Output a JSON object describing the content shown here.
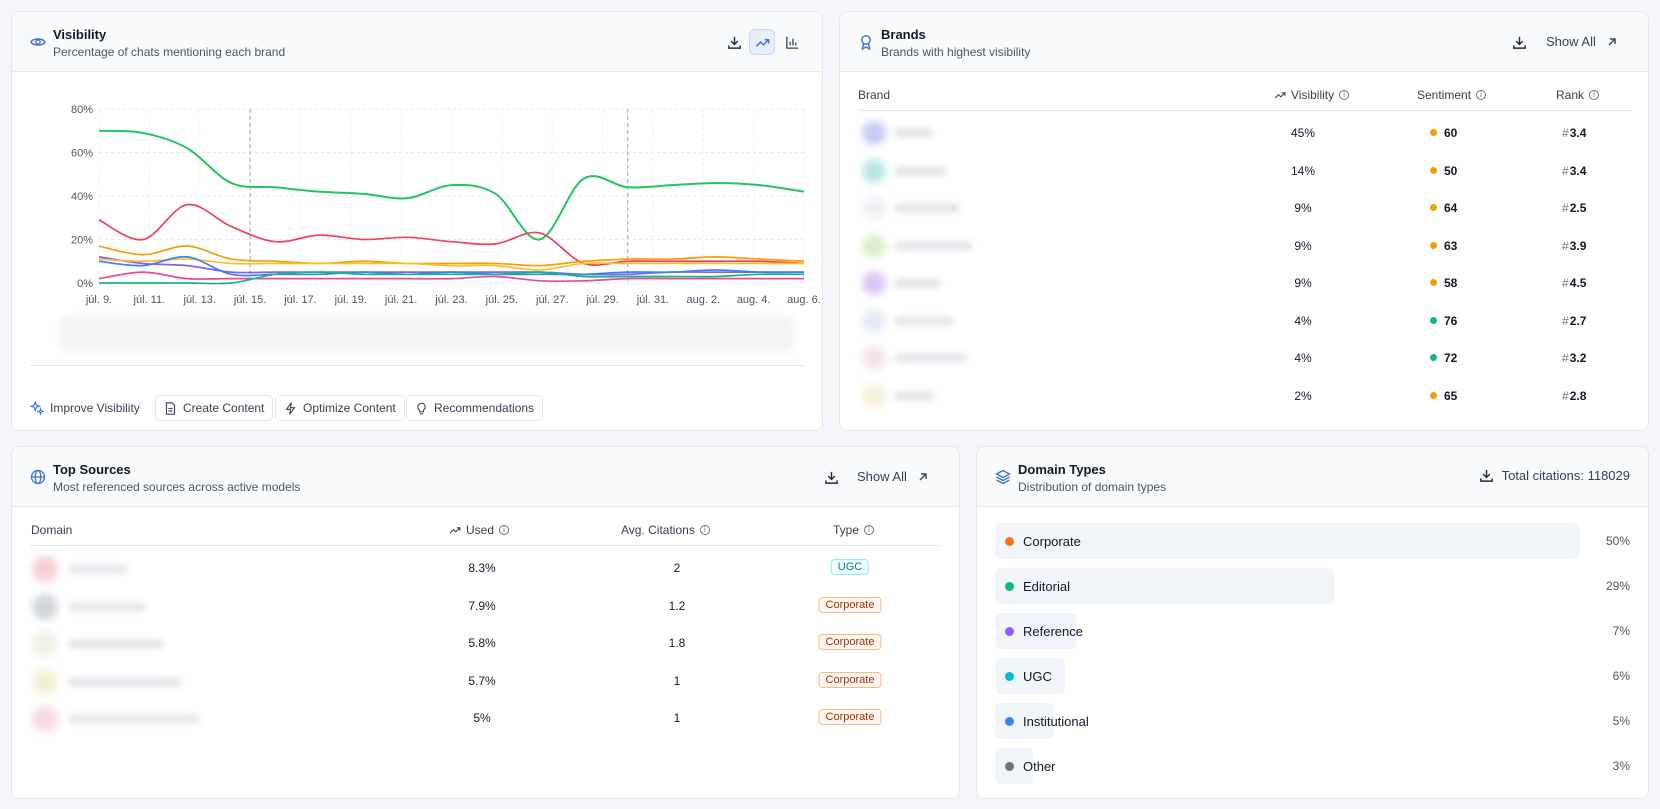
{
  "visibility": {
    "title": "Visibility",
    "subtitle": "Percentage of chats mentioning each brand",
    "icons": [
      "eye-icon",
      "download-icon",
      "trend-icon",
      "bar-chart-icon"
    ],
    "actions": [
      "Improve Visibility",
      "Create Content",
      "Optimize Content",
      "Recommendations"
    ]
  },
  "chart_data": {
    "type": "line",
    "x": [
      "júl. 9.",
      "júl. 11.",
      "júl. 13.",
      "júl. 15.",
      "júl. 17.",
      "júl. 19.",
      "júl. 21.",
      "júl. 23.",
      "júl. 25.",
      "júl. 27.",
      "júl. 29.",
      "júl. 31.",
      "aug. 2.",
      "aug. 4.",
      "aug. 6."
    ],
    "yticks": [
      "0%",
      "20%",
      "40%",
      "60%",
      "80%"
    ],
    "ylim": [
      0,
      80
    ],
    "grid": true,
    "series": [
      {
        "color": "#22c55e",
        "values": [
          70,
          69,
          62,
          46,
          44,
          42,
          41,
          39,
          45,
          41,
          20,
          48,
          44,
          45,
          46,
          45,
          42
        ]
      },
      {
        "color": "#f43f5e",
        "values": [
          29,
          20,
          36,
          26,
          19,
          22,
          20,
          21,
          19,
          18,
          23,
          9,
          10,
          10,
          10,
          10,
          9
        ]
      },
      {
        "color": "#f59e0b",
        "values": [
          17,
          13,
          17,
          11,
          10,
          9,
          10,
          9,
          9,
          9,
          8,
          10,
          11,
          11,
          12,
          11,
          10
        ]
      },
      {
        "color": "#8b5cf6",
        "values": [
          12,
          9,
          8,
          5,
          5,
          5,
          5,
          5,
          5,
          5,
          5,
          4,
          4,
          5,
          5,
          5,
          5
        ]
      },
      {
        "color": "#fbbf24",
        "values": [
          11,
          10,
          11,
          9,
          9,
          9,
          9,
          9,
          8,
          8,
          6,
          9,
          9,
          9,
          9,
          9,
          9
        ]
      },
      {
        "color": "#ec4899",
        "values": [
          2,
          5,
          2,
          2,
          2,
          2,
          2,
          2,
          2,
          3,
          1,
          1,
          2,
          2,
          2,
          2,
          2
        ]
      },
      {
        "color": "#3b82f6",
        "values": [
          10,
          8,
          12,
          4,
          4,
          4,
          5,
          4,
          5,
          4,
          4,
          4,
          5,
          5,
          6,
          5,
          5
        ]
      },
      {
        "color": "#10b981",
        "values": [
          0,
          0,
          0,
          0,
          4,
          5,
          4,
          4,
          4,
          4,
          5,
          3,
          3,
          3,
          3,
          4,
          4
        ]
      }
    ]
  },
  "brands": {
    "title": "Brands",
    "subtitle": "Brands with highest visibility",
    "show_all": "Show All",
    "columns": {
      "brand": "Brand",
      "visibility": "Visibility",
      "sentiment": "Sentiment",
      "rank": "Rank"
    },
    "rows": [
      {
        "visibility": "45%",
        "sentiment": "60",
        "sentiment_color": "#f59e0b",
        "rank": "3.4"
      },
      {
        "visibility": "14%",
        "sentiment": "50",
        "sentiment_color": "#f59e0b",
        "rank": "3.4"
      },
      {
        "visibility": "9%",
        "sentiment": "64",
        "sentiment_color": "#f59e0b",
        "rank": "2.5"
      },
      {
        "visibility": "9%",
        "sentiment": "63",
        "sentiment_color": "#f59e0b",
        "rank": "3.9"
      },
      {
        "visibility": "9%",
        "sentiment": "58",
        "sentiment_color": "#f59e0b",
        "rank": "4.5"
      },
      {
        "visibility": "4%",
        "sentiment": "76",
        "sentiment_color": "#10b981",
        "rank": "2.7"
      },
      {
        "visibility": "4%",
        "sentiment": "72",
        "sentiment_color": "#10b981",
        "rank": "3.2"
      },
      {
        "visibility": "2%",
        "sentiment": "65",
        "sentiment_color": "#f59e0b",
        "rank": "2.8"
      }
    ],
    "rank_prefix": "#"
  },
  "top_sources": {
    "title": "Top Sources",
    "subtitle": "Most referenced sources across active models",
    "show_all": "Show All",
    "columns": {
      "domain": "Domain",
      "used": "Used",
      "avg": "Avg. Citations",
      "type": "Type"
    },
    "rows": [
      {
        "used": "8.3%",
        "avg": "2",
        "type": "UGC"
      },
      {
        "used": "7.9%",
        "avg": "1.2",
        "type": "Corporate"
      },
      {
        "used": "5.8%",
        "avg": "1.8",
        "type": "Corporate"
      },
      {
        "used": "5.7%",
        "avg": "1",
        "type": "Corporate"
      },
      {
        "used": "5%",
        "avg": "1",
        "type": "Corporate"
      }
    ]
  },
  "domain_types": {
    "title": "Domain Types",
    "subtitle": "Distribution of domain types",
    "total_label": "Total citations: 118029",
    "rows": [
      {
        "name": "Corporate",
        "pct": "50%",
        "value": 50,
        "color": "#f97316"
      },
      {
        "name": "Editorial",
        "pct": "29%",
        "value": 29,
        "color": "#10b981"
      },
      {
        "name": "Reference",
        "pct": "7%",
        "value": 7,
        "color": "#8b5cf6"
      },
      {
        "name": "UGC",
        "pct": "6%",
        "value": 6,
        "color": "#06b6d4"
      },
      {
        "name": "Institutional",
        "pct": "5%",
        "value": 5,
        "color": "#3b82f6"
      },
      {
        "name": "Other",
        "pct": "3%",
        "value": 3,
        "color": "#6b7280"
      }
    ]
  }
}
